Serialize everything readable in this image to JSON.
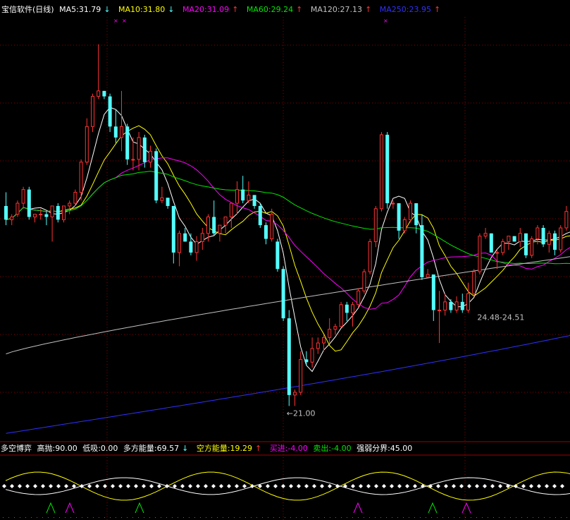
{
  "header": {
    "title": "宝信软件(日线)",
    "ma5_label": "MA5:31.79",
    "ma5_arrow": "↓",
    "ma10_label": "MA10:31.80",
    "ma10_arrow": "↓",
    "ma20_label": "MA20:31.09",
    "ma20_arrow": "↑",
    "ma60_label": "MA60:29.24",
    "ma60_arrow": "↑",
    "ma120_label": "MA120:27.13",
    "ma120_arrow": "↑",
    "ma250_label": "MA250:23.95",
    "ma250_arrow": "↑"
  },
  "indicator": {
    "name": "多空博弈",
    "high_label": "高抛:90.00",
    "low_label": "低吸:0.00",
    "bull_label": "多方能量:69.57",
    "bull_arrow": "↓",
    "bear_label": "空方能量:19.29",
    "bear_arrow": "↑",
    "buy_label": "买进:-4.00",
    "sell_label": "卖出:-4.00",
    "divide_label": "强弱分界:45.00"
  },
  "colors": {
    "up": "#ff3232",
    "down": "#54ffff",
    "ma5": "#ffffff",
    "ma10": "#ffff00",
    "ma20": "#ff00ff",
    "ma60": "#00e600",
    "ma120": "#c0c0c0",
    "ma250": "#3030ff",
    "grid": "#8b0000",
    "background": "#000000"
  },
  "chart_data": {
    "type": "candlestick",
    "price_range": [
      19.8,
      35.2
    ],
    "annotations": [
      {
        "text": "←21.00",
        "index": 49,
        "value": 21.0
      },
      {
        "text": "24.48-24.51",
        "index": 82,
        "value": 24.5
      }
    ],
    "candles": [
      [
        28.3,
        28.8,
        27.6,
        27.8
      ],
      [
        27.8,
        28.0,
        27.6,
        27.9
      ],
      [
        28.0,
        28.5,
        27.9,
        28.4
      ],
      [
        28.4,
        29.0,
        28.2,
        28.9
      ],
      [
        28.9,
        29.0,
        27.8,
        27.9
      ],
      [
        27.9,
        28.0,
        27.7,
        28.0
      ],
      [
        28.0,
        28.2,
        27.8,
        28.0
      ],
      [
        28.0,
        28.1,
        27.6,
        27.9
      ],
      [
        27.9,
        28.3,
        27.0,
        28.3
      ],
      [
        28.3,
        28.4,
        27.7,
        27.8
      ],
      [
        27.8,
        28.3,
        27.7,
        28.3
      ],
      [
        28.3,
        28.5,
        28.0,
        28.4
      ],
      [
        28.4,
        28.9,
        28.3,
        28.8
      ],
      [
        28.8,
        30.0,
        28.5,
        29.9
      ],
      [
        29.9,
        31.5,
        29.8,
        31.2
      ],
      [
        31.2,
        32.4,
        31.0,
        32.3
      ],
      [
        32.3,
        34.2,
        32.2,
        32.5
      ],
      [
        32.5,
        32.5,
        32.2,
        32.3
      ],
      [
        32.3,
        32.4,
        31.0,
        31.2
      ],
      [
        31.2,
        31.8,
        30.6,
        30.8
      ],
      [
        30.8,
        32.5,
        30.3,
        31.2
      ],
      [
        31.2,
        31.3,
        29.8,
        30.0
      ],
      [
        30.0,
        30.8,
        29.6,
        30.0
      ],
      [
        30.0,
        31.0,
        29.6,
        30.8
      ],
      [
        30.8,
        30.9,
        29.7,
        29.9
      ],
      [
        29.9,
        30.5,
        29.7,
        30.3
      ],
      [
        30.3,
        30.4,
        28.4,
        28.5
      ],
      [
        28.5,
        29.0,
        28.4,
        28.6
      ],
      [
        28.6,
        28.6,
        28.2,
        28.3
      ],
      [
        28.3,
        28.3,
        26.2,
        26.6
      ],
      [
        26.6,
        27.4,
        26.1,
        27.3
      ],
      [
        27.3,
        27.5,
        27.0,
        27.0
      ],
      [
        27.0,
        27.3,
        26.5,
        26.6
      ],
      [
        26.6,
        27.2,
        26.3,
        27.0
      ],
      [
        27.0,
        27.5,
        26.7,
        27.3
      ],
      [
        27.3,
        28.0,
        27.0,
        27.9
      ],
      [
        27.9,
        28.5,
        27.2,
        27.3
      ],
      [
        27.3,
        27.6,
        27.0,
        27.6
      ],
      [
        27.6,
        27.9,
        27.3,
        27.9
      ],
      [
        27.9,
        28.4,
        27.5,
        28.4
      ],
      [
        28.4,
        29.2,
        28.0,
        28.9
      ],
      [
        28.9,
        29.4,
        28.4,
        28.5
      ],
      [
        28.5,
        29.2,
        28.4,
        28.7
      ],
      [
        28.7,
        28.7,
        28.2,
        28.3
      ],
      [
        28.3,
        28.4,
        27.5,
        27.6
      ],
      [
        27.6,
        27.7,
        26.9,
        27.1
      ],
      [
        27.1,
        28.2,
        27.0,
        28.0
      ],
      [
        27.0,
        27.1,
        25.9,
        26.0
      ],
      [
        26.0,
        26.1,
        24.1,
        24.2
      ],
      [
        24.2,
        24.5,
        21.0,
        21.4
      ],
      [
        21.4,
        21.6,
        21.0,
        21.5
      ],
      [
        21.5,
        23.0,
        21.4,
        22.7
      ],
      [
        22.7,
        23.0,
        22.5,
        22.6
      ],
      [
        22.6,
        23.5,
        22.4,
        23.1
      ],
      [
        23.1,
        23.5,
        22.9,
        23.3
      ],
      [
        23.3,
        23.6,
        23.0,
        23.5
      ],
      [
        23.5,
        24.2,
        23.3,
        23.8
      ],
      [
        23.8,
        24.0,
        23.6,
        23.9
      ],
      [
        23.9,
        24.8,
        23.9,
        24.7
      ],
      [
        24.7,
        24.8,
        24.1,
        24.4
      ],
      [
        24.4,
        24.8,
        23.9,
        24.7
      ],
      [
        24.7,
        25.3,
        24.6,
        25.2
      ],
      [
        25.2,
        26.0,
        25.1,
        25.9
      ],
      [
        25.9,
        27.1,
        25.8,
        27.0
      ],
      [
        27.0,
        28.3,
        26.8,
        28.2
      ],
      [
        28.2,
        31.0,
        28.1,
        30.9
      ],
      [
        30.9,
        31.0,
        28.2,
        28.4
      ],
      [
        28.4,
        28.5,
        28.2,
        28.4
      ],
      [
        28.4,
        28.4,
        27.1,
        27.4
      ],
      [
        27.4,
        27.9,
        27.3,
        27.8
      ],
      [
        27.8,
        28.5,
        27.7,
        28.4
      ],
      [
        28.4,
        28.4,
        27.3,
        27.6
      ],
      [
        27.6,
        28.0,
        25.6,
        25.7
      ],
      [
        25.7,
        26.0,
        25.7,
        25.8
      ],
      [
        25.8,
        25.8,
        24.1,
        24.5
      ],
      [
        24.5,
        25.2,
        23.3,
        24.5
      ],
      [
        24.5,
        25.1,
        24.3,
        24.8
      ],
      [
        24.8,
        24.9,
        24.4,
        24.5
      ],
      [
        24.5,
        25.0,
        24.4,
        24.8
      ],
      [
        24.8,
        25.1,
        24.4,
        24.5
      ],
      [
        24.5,
        25.5,
        24.4,
        25.1
      ],
      [
        25.1,
        26.0,
        25.0,
        25.9
      ],
      [
        25.9,
        27.3,
        25.8,
        27.2
      ],
      [
        27.2,
        27.5,
        27.1,
        27.3
      ],
      [
        27.3,
        27.3,
        26.6,
        26.6
      ],
      [
        26.6,
        26.7,
        26.0,
        26.6
      ],
      [
        26.6,
        27.1,
        26.5,
        27.0
      ],
      [
        27.0,
        27.2,
        26.7,
        27.2
      ],
      [
        27.2,
        27.2,
        27.0,
        27.0
      ],
      [
        27.0,
        27.5,
        26.8,
        27.3
      ],
      [
        27.3,
        27.3,
        26.4,
        26.5
      ],
      [
        26.5,
        27.2,
        26.4,
        27.1
      ],
      [
        27.1,
        27.6,
        26.9,
        27.5
      ],
      [
        27.5,
        27.6,
        26.8,
        26.9
      ],
      [
        26.9,
        27.4,
        26.6,
        27.3
      ],
      [
        27.3,
        27.4,
        26.5,
        26.7
      ],
      [
        26.7,
        27.6,
        26.6,
        27.5
      ],
      [
        27.5,
        28.3,
        27.4,
        28.1
      ],
      [
        28.1,
        28.2,
        26.9,
        27.3
      ],
      [
        27.3,
        28.2,
        27.0,
        28.1
      ],
      [
        28.1,
        28.4,
        27.4,
        27.7
      ],
      [
        27.7,
        28.8,
        27.5,
        28.7
      ],
      [
        28.7,
        29.2,
        28.3,
        28.4
      ],
      [
        28.4,
        28.5,
        27.5,
        27.6
      ],
      [
        27.6,
        28.3,
        27.5,
        28.2
      ],
      [
        28.2,
        28.7,
        27.6,
        27.7
      ],
      [
        27.7,
        28.3,
        27.5,
        28.2
      ],
      [
        28.2,
        28.8,
        27.8,
        28.7
      ],
      [
        28.7,
        29.0,
        28.3,
        28.4
      ],
      [
        28.4,
        29.2,
        28.2,
        29.1
      ],
      [
        29.1,
        29.3,
        27.4,
        27.7
      ],
      [
        27.7,
        29.2,
        27.4,
        29.0
      ],
      [
        29.0,
        29.6,
        28.8,
        29.2
      ],
      [
        29.2,
        29.3,
        28.6,
        28.8
      ],
      [
        28.8,
        29.3,
        28.7,
        29.2
      ],
      [
        29.2,
        30.0,
        29.1,
        29.9
      ],
      [
        29.9,
        30.5,
        29.6,
        30.3
      ],
      [
        30.3,
        31.0,
        30.1,
        30.9
      ],
      [
        30.9,
        31.2,
        29.2,
        29.5
      ],
      [
        29.5,
        32.0,
        29.4,
        31.9
      ]
    ],
    "indicator_levels": {
      "high": 90,
      "low": 0,
      "divide": 45
    }
  }
}
